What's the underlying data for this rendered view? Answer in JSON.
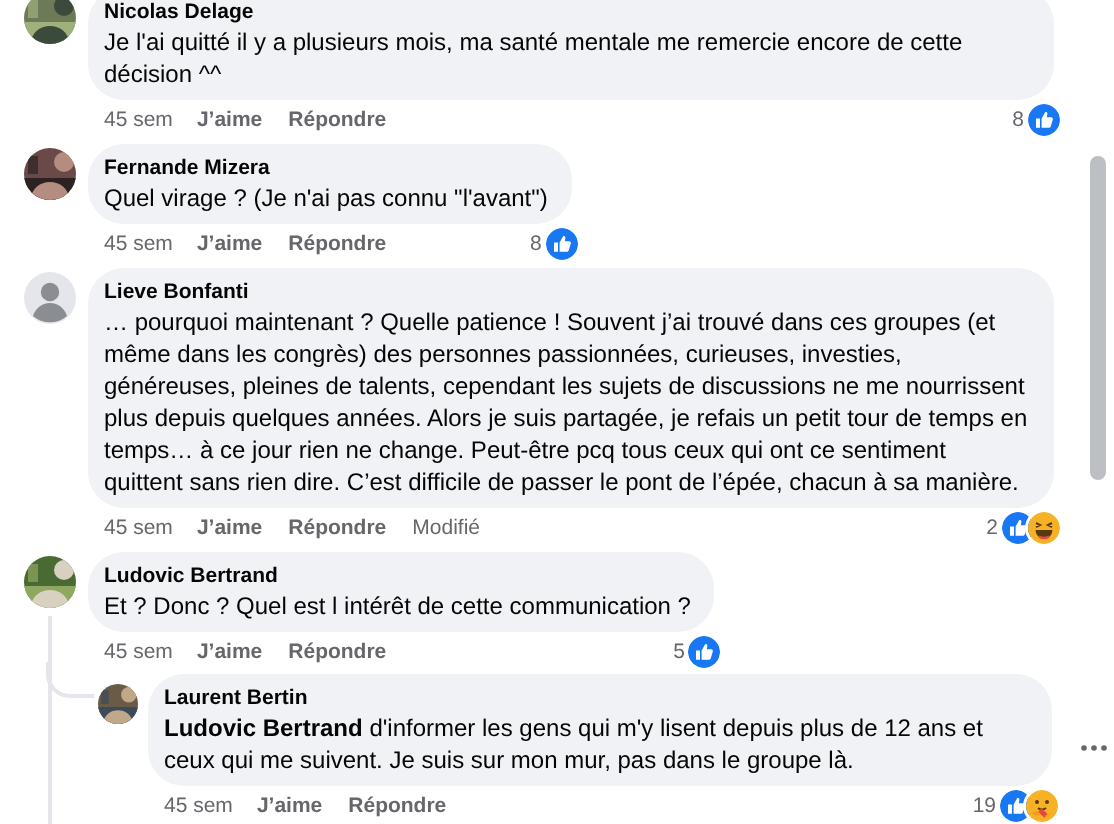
{
  "comments": [
    {
      "author": "Nicolas Delage",
      "avatar": {
        "kind": "picture"
      },
      "text": "Je l'ai quitté il y a plusieurs mois, ma santé mentale me remercie encore de cette décision ^^",
      "time": "45 sem",
      "like_label": "J’aime",
      "reply_label": "Répondre",
      "reaction_count": "8",
      "reactions": [
        {
          "kind": "like"
        }
      ]
    },
    {
      "author": "Fernande Mizera",
      "avatar": {
        "kind": "picture"
      },
      "text": "Quel virage ? (Je n'ai pas connu \"l'avant\")",
      "time": "45 sem",
      "like_label": "J’aime",
      "reply_label": "Répondre",
      "reaction_count": "8",
      "reactions": [
        {
          "kind": "like"
        }
      ]
    },
    {
      "author": "Lieve Bonfanti",
      "avatar": {
        "kind": "default"
      },
      "text": "… pourquoi maintenant ? Quelle patience ! Souvent j’ai trouvé dans ces groupes (et même dans les congrès) des personnes passionnées, curieuses, investies, généreuses, pleines de talents, cependant les sujets de discussions ne me nourrissent plus depuis quelques années. Alors je suis partagée, je refais un petit tour de temps en temps… à ce jour rien ne change. Peut-être pcq tous ceux qui ont ce sentiment quittent sans rien dire. C’est difficile de passer le pont de l’épée, chacun à sa manière.",
      "time": "45 sem",
      "like_label": "J’aime",
      "reply_label": "Répondre",
      "edited_label": "Modifié",
      "reaction_count": "2",
      "reactions": [
        {
          "kind": "like"
        },
        {
          "kind": "haha"
        }
      ]
    },
    {
      "author": "Ludovic Bertrand",
      "avatar": {
        "kind": "picture"
      },
      "text": "Et ? Donc ? Quel est l intérêt de cette communication ?",
      "time": "45 sem",
      "like_label": "J’aime",
      "reply_label": "Répondre",
      "reaction_count": "5",
      "reactions": [
        {
          "kind": "like"
        }
      ],
      "replies": [
        {
          "author": "Laurent Bertin",
          "avatar": {
            "kind": "picture"
          },
          "text": "**Ludovic Bertrand** d'informer les gens qui m'y lisent depuis plus de 12 ans et ceux qui me suivent. Je suis sur mon mur, pas dans le groupe là.",
          "time": "45 sem",
          "like_label": "J’aime",
          "reply_label": "Répondre",
          "reaction_count": "19",
          "reactions": [
            {
              "kind": "like"
            },
            {
              "kind": "care"
            }
          ],
          "menu_button": true
        }
      ]
    }
  ]
}
